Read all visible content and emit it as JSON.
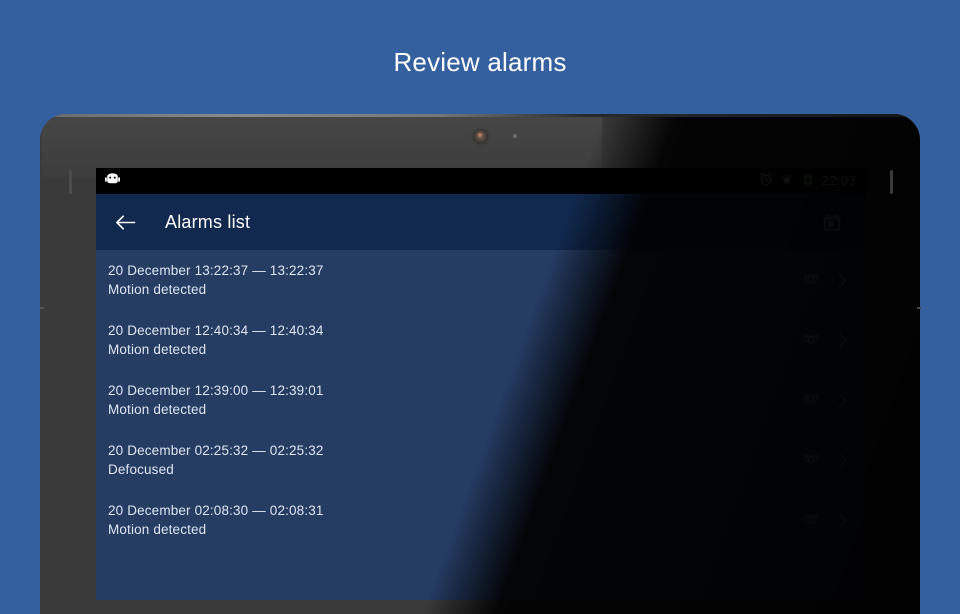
{
  "promo": {
    "title": "Review alarms"
  },
  "device": {
    "front_camera_icon": "front-camera-icon",
    "front_sensor_icon": "proximity-sensor-icon"
  },
  "statusbar": {
    "android_icon": "android-robot-icon",
    "alarm_icon": "alarm-clock-icon",
    "wifi_icon": "wifi-icon",
    "battery_icon": "battery-charging-icon",
    "battery_color": "#5ec75e",
    "clock": "22:03"
  },
  "appbar": {
    "back_icon": "back-arrow-icon",
    "title": "Alarms list",
    "calendar_icon": "calendar-icon",
    "background": "#11294f",
    "accent": "#8ab8ef"
  },
  "list": {
    "background": "#253c63",
    "rows": [
      {
        "date_time": "20 December  13:22:37 — 13:22:37",
        "event": "Motion detected",
        "camera_icon": "cctv-dome-camera-icon",
        "chevron_icon": "chevron-right-icon"
      },
      {
        "date_time": "20 December  12:40:34 — 12:40:34",
        "event": "Motion detected",
        "camera_icon": "cctv-dome-camera-icon",
        "chevron_icon": "chevron-right-icon"
      },
      {
        "date_time": "20 December  12:39:00 — 12:39:01",
        "event": "Motion detected",
        "camera_icon": "cctv-dome-camera-icon",
        "chevron_icon": "chevron-right-icon"
      },
      {
        "date_time": "20 December  02:25:32 — 02:25:32",
        "event": "Defocused",
        "camera_icon": "cctv-dome-camera-icon",
        "chevron_icon": "chevron-right-icon"
      },
      {
        "date_time": "20 December  02:08:30 — 02:08:31",
        "event": "Motion detected",
        "camera_icon": "cctv-dome-camera-icon",
        "chevron_icon": "chevron-right-icon"
      }
    ]
  },
  "theme": {
    "page_background": "#35609f",
    "heading_color": "#ffffff"
  }
}
